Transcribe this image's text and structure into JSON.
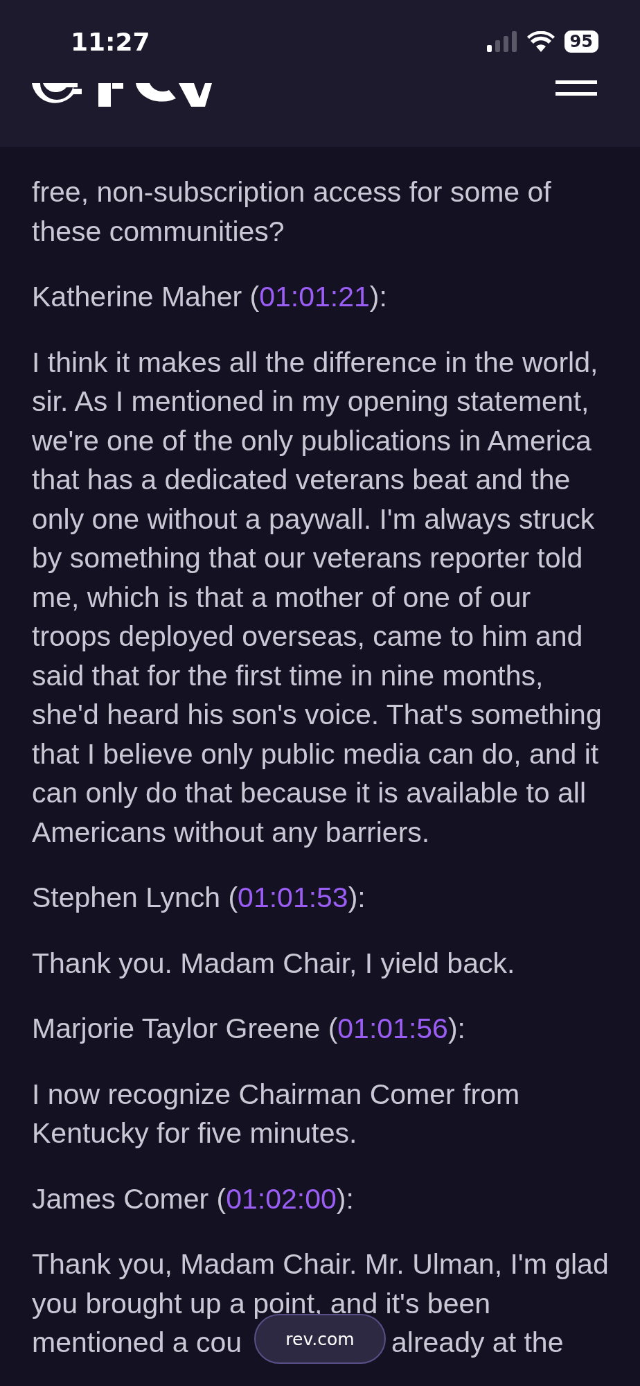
{
  "status_bar": {
    "time": "11:27",
    "battery": "95"
  },
  "transcript": [
    {
      "kind": "text",
      "text": "free, non-subscription access for some of\nthese communities?"
    },
    {
      "kind": "speaker",
      "name": "Katherine Maher",
      "open": "(",
      "timestamp": "01:01:21",
      "close": "):"
    },
    {
      "kind": "text",
      "text": "I think it makes all the difference in the world,\nsir. As I mentioned in my opening statement,\nwe're one of the only publications in America\nthat has a dedicated veterans beat and the\nonly one without a paywall. I'm always struck\nby something that our veterans reporter told\nme, which is that a mother of one of our\ntroops deployed overseas, came to him and\nsaid that for the first time in nine months,\nshe'd heard his son's voice. That's something\nthat I believe only public media can do, and it\ncan only do that because it is available to all\nAmericans without any barriers."
    },
    {
      "kind": "speaker",
      "name": "Stephen Lynch",
      "open": "(",
      "timestamp": "01:01:53",
      "close": "):"
    },
    {
      "kind": "text",
      "text": "Thank you. Madam Chair, I yield back."
    },
    {
      "kind": "speaker",
      "name": "Marjorie Taylor Greene",
      "open": "(",
      "timestamp": "01:01:56",
      "close": "):"
    },
    {
      "kind": "text",
      "text": "I now recognize Chairman Comer from\nKentucky for five minutes."
    },
    {
      "kind": "speaker",
      "name": "James Comer",
      "open": "(",
      "timestamp": "01:02:00",
      "close": "):"
    },
    {
      "kind": "text",
      "text": "Thank you, Madam Chair. Mr. Ulman, I'm glad\nyou brought up a point, and it's been"
    },
    {
      "kind": "split",
      "left": "mentioned a cou",
      "right": "already at the"
    }
  ],
  "address_pill": {
    "url": "rev.com"
  }
}
